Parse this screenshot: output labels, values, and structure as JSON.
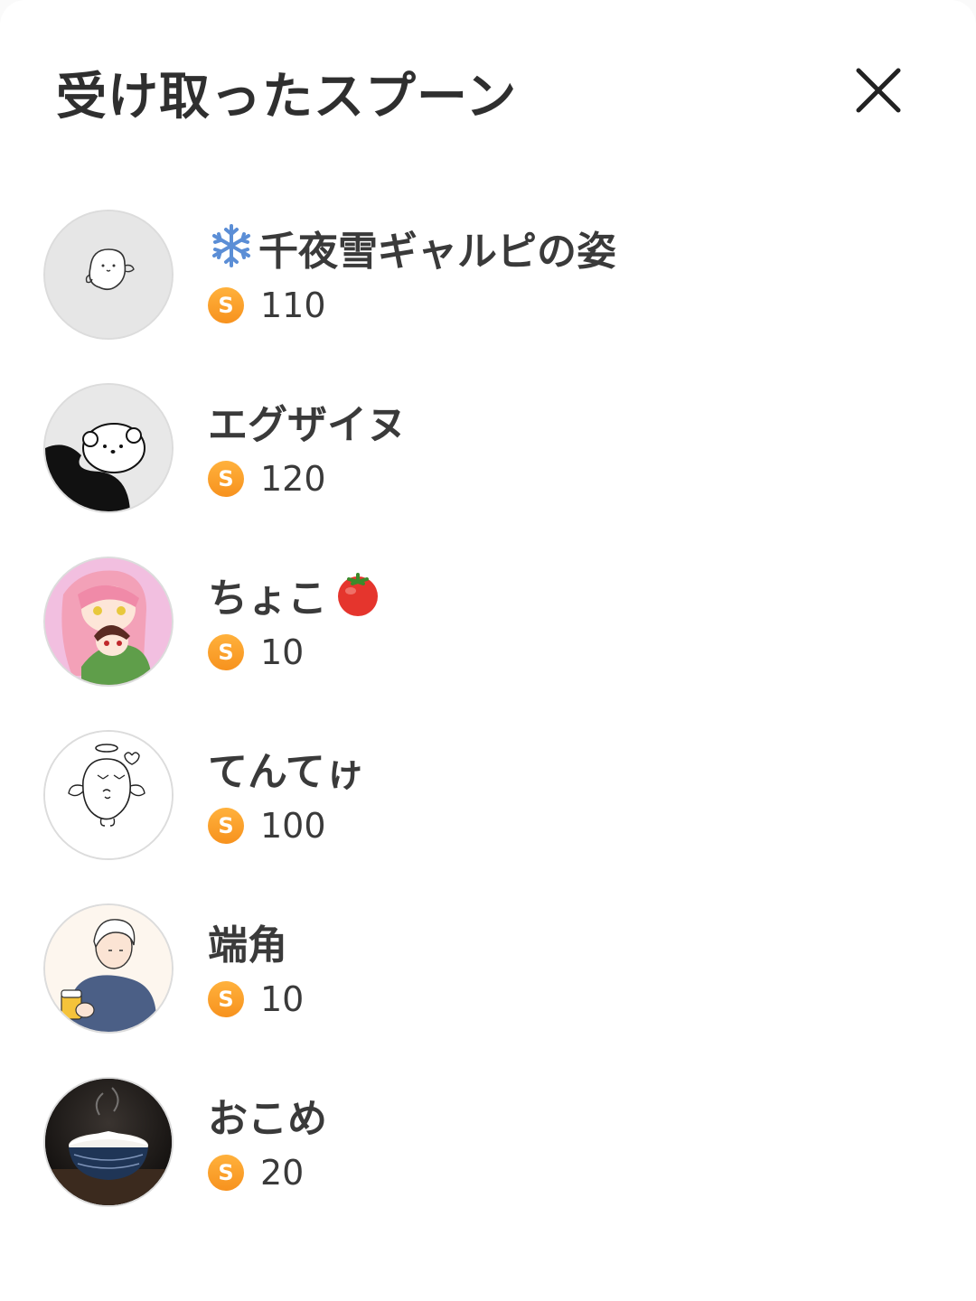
{
  "header": {
    "title": "受け取ったスプーン",
    "close_icon": "close-icon"
  },
  "spoon_icon_letter": "S",
  "colors": {
    "coin": "#f7921e",
    "text": "#333333",
    "avatar_border": "#dcdcdc"
  },
  "senders": [
    {
      "name": "千夜雪ギャルピの姿",
      "leading_emoji": "snowflake-icon",
      "trailing_emoji": "",
      "amount": "110",
      "avatar": "doodle-ghost-avatar"
    },
    {
      "name": "エグザイヌ",
      "leading_emoji": "",
      "trailing_emoji": "",
      "amount": "120",
      "avatar": "doodle-dog-avatar"
    },
    {
      "name": "ちょこ",
      "leading_emoji": "",
      "trailing_emoji": "tomato-icon",
      "amount": "10",
      "avatar": "anime-couple-avatar"
    },
    {
      "name": "てんてゖ",
      "leading_emoji": "",
      "trailing_emoji": "",
      "amount": "100",
      "avatar": "angel-doodle-avatar"
    },
    {
      "name": "端角",
      "leading_emoji": "",
      "trailing_emoji": "",
      "amount": "10",
      "avatar": "man-with-beer-avatar"
    },
    {
      "name": "おこめ",
      "leading_emoji": "",
      "trailing_emoji": "",
      "amount": "20",
      "avatar": "rice-bowl-avatar"
    }
  ]
}
